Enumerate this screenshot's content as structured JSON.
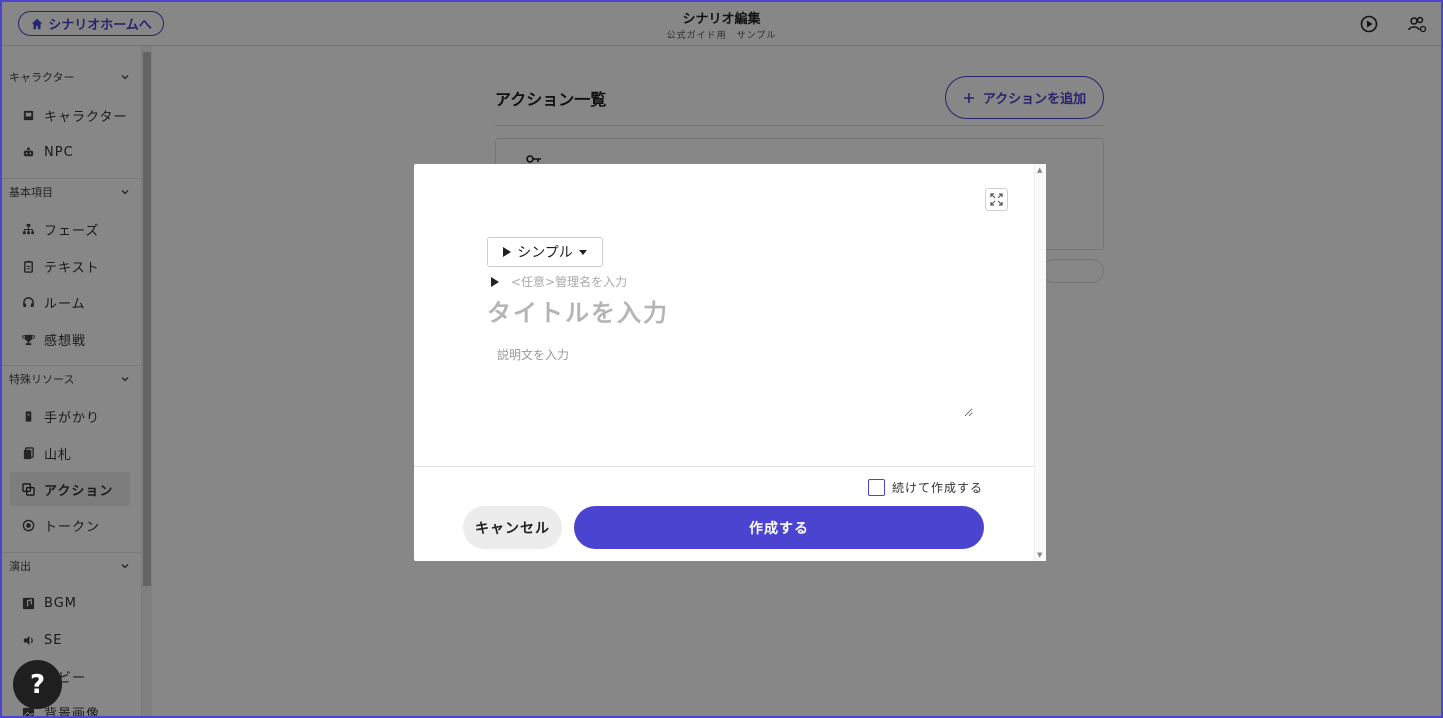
{
  "header": {
    "home_button": "シナリオホームへ",
    "title": "シナリオ編集",
    "subtitle": "公式ガイド用　サンプル",
    "icons": [
      "home-icon",
      "play-circle-icon",
      "users-settings-icon"
    ]
  },
  "sidebar": {
    "sections": [
      {
        "label": "キャラクター"
      },
      {
        "label": "基本項目"
      },
      {
        "label": "特殊リソース"
      },
      {
        "label": "演出"
      }
    ],
    "items": [
      {
        "label": "キャラクター",
        "icon": "character-card-icon"
      },
      {
        "label": "NPC",
        "icon": "robot-icon"
      },
      {
        "label": "フェーズ",
        "icon": "hierarchy-icon"
      },
      {
        "label": "テキスト",
        "icon": "clipboard-icon"
      },
      {
        "label": "ルーム",
        "icon": "headphones-icon"
      },
      {
        "label": "感想戦",
        "icon": "trophy-icon"
      },
      {
        "label": "手がかり",
        "icon": "card-icon"
      },
      {
        "label": "山札",
        "icon": "deck-icon"
      },
      {
        "label": "アクション",
        "icon": "action-icon",
        "active": true
      },
      {
        "label": "トークン",
        "icon": "token-icon"
      },
      {
        "label": "BGM",
        "icon": "music-icon"
      },
      {
        "label": "SE",
        "icon": "speaker-icon"
      },
      {
        "label": "ービー",
        "icon": "movie-icon"
      },
      {
        "label": "背景画像",
        "icon": "image-icon"
      }
    ]
  },
  "main": {
    "title": "アクション一覧",
    "add_button": "アクションを追加"
  },
  "modal": {
    "type_select": "シンプル",
    "management_placeholder": "<任意>管理名を入力",
    "title_placeholder": "タイトルを入力",
    "description_placeholder": "説明文を入力",
    "continue_label": "続けて作成する",
    "continue_checked": false,
    "cancel_label": "キャンセル",
    "create_label": "作成する"
  },
  "help": {
    "label": "?"
  },
  "colors": {
    "accent": "#4a44d0",
    "overlay": "rgba(0,0,0,0.47)"
  }
}
